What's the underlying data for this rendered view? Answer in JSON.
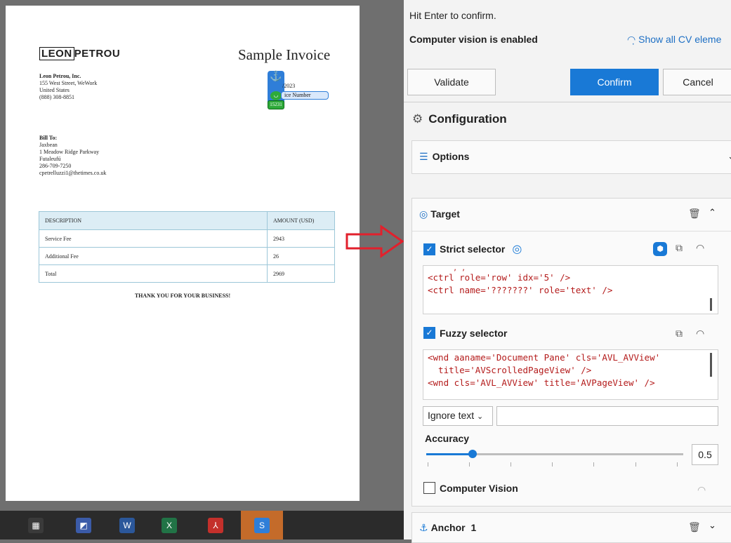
{
  "document": {
    "logo_boxed": "LEON",
    "logo_rest": "PETROU",
    "title": "Sample Invoice",
    "company": [
      "Leon Petrou, Inc.",
      "155 West Street, WeWork",
      "United States",
      "(888) 308-8851"
    ],
    "bill_to": [
      "Bill To:",
      "Jaxbean",
      "1 Meadow Ridge Parkway",
      "Futaleufú",
      "286-709-7250",
      "cpetrelluzzi1@thetimes.co.uk"
    ],
    "date_fragment": "/2023",
    "invoice_number_label": "ice Number",
    "invoice_number_value": "15231",
    "table": {
      "headers": [
        "DESCRIPTION",
        "AMOUNT (USD)"
      ],
      "rows": [
        [
          "Service Fee",
          "2943"
        ],
        [
          "Additional Fee",
          "26"
        ],
        [
          "Total",
          "2969"
        ]
      ]
    },
    "thanks": "THANK YOU FOR YOUR BUSINESS!"
  },
  "panel": {
    "hint": "Hit Enter to confirm.",
    "cv_status": "Computer vision is enabled",
    "show_cv": "Show all CV eleme",
    "buttons": {
      "validate": "Validate",
      "confirm": "Confirm",
      "cancel": "Cancel"
    },
    "configuration": "Configuration",
    "options": "Options",
    "target": "Target",
    "strict_selector": "Strict selector",
    "strict_code": [
      "<ctrl role='row' idx='5' />",
      "<ctrl name='???????' role='text' />"
    ],
    "fuzzy_selector": "Fuzzy selector",
    "fuzzy_code": [
      "<wnd aaname='Document Pane' cls='AVL_AVView'",
      "  title='AVScrolledPageView' />",
      "<wnd cls='AVL_AVView' title='AVPageView' />"
    ],
    "ignore_text": "Ignore text",
    "accuracy": "Accuracy",
    "accuracy_value": "0.5",
    "accuracy_fraction": 0.18,
    "computer_vision": "Computer Vision",
    "anchor": "Anchor",
    "anchor_count": "1"
  },
  "colors": {
    "accent": "#1979d6",
    "annotation_red": "#e2202c"
  }
}
